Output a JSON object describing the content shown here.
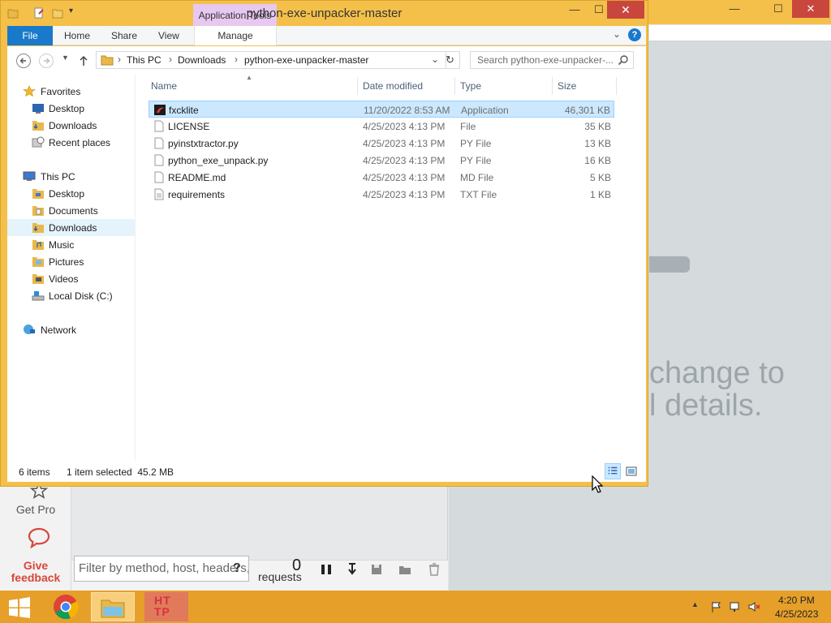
{
  "window": {
    "title": "python-exe-unpacker-master",
    "context_tab": "Application Tools",
    "controls": {
      "minimize": "—",
      "maximize": "☐",
      "close": "✕"
    }
  },
  "ribbon": {
    "tabs": [
      "File",
      "Home",
      "Share",
      "View",
      "Manage"
    ]
  },
  "address": {
    "crumbs": [
      "This PC",
      "Downloads",
      "python-exe-unpacker-master"
    ],
    "search_placeholder": "Search python-exe-unpacker-..."
  },
  "nav_pane": {
    "favorites": {
      "label": "Favorites",
      "items": [
        "Desktop",
        "Downloads",
        "Recent places"
      ]
    },
    "this_pc": {
      "label": "This PC",
      "items": [
        "Desktop",
        "Documents",
        "Downloads",
        "Music",
        "Pictures",
        "Videos",
        "Local Disk (C:)"
      ]
    },
    "network": {
      "label": "Network"
    },
    "selected": "Downloads"
  },
  "columns": {
    "name": "Name",
    "date": "Date modified",
    "type": "Type",
    "size": "Size"
  },
  "files": [
    {
      "name": "fxcklite",
      "date": "11/20/2022 8:53 AM",
      "type": "Application",
      "size": "46,301 KB",
      "selected": true,
      "icon": "application-icon"
    },
    {
      "name": "LICENSE",
      "date": "4/25/2023 4:13 PM",
      "type": "File",
      "size": "35 KB",
      "selected": false,
      "icon": "file-icon"
    },
    {
      "name": "pyinstxtractor.py",
      "date": "4/25/2023 4:13 PM",
      "type": "PY File",
      "size": "13 KB",
      "selected": false,
      "icon": "file-icon"
    },
    {
      "name": "python_exe_unpack.py",
      "date": "4/25/2023 4:13 PM",
      "type": "PY File",
      "size": "16 KB",
      "selected": false,
      "icon": "file-icon"
    },
    {
      "name": "README.md",
      "date": "4/25/2023 4:13 PM",
      "type": "MD File",
      "size": "5 KB",
      "selected": false,
      "icon": "file-icon"
    },
    {
      "name": "requirements",
      "date": "4/25/2023 4:13 PM",
      "type": "TXT File",
      "size": "1 KB",
      "selected": false,
      "icon": "text-file-icon"
    }
  ],
  "status": {
    "count": "6 items",
    "selection": "1 item selected  45.2 MB"
  },
  "background_app": {
    "message": "change to\nl details.",
    "get_pro": "Get Pro",
    "feedback": "Give\nfeedback",
    "filter_placeholder": "Filter by method, host, headers, s",
    "help": "?",
    "request_count": "0",
    "requests_label": "requests"
  },
  "taskbar": {
    "http_label": "HT\nTP",
    "time": "4:20 PM",
    "date": "4/25/2023"
  },
  "colors": {
    "accent": "#1979ca",
    "title_bar": "#f4c04a",
    "taskbar": "#e6a02a",
    "selection": "#cce8ff",
    "close": "#c9463d"
  }
}
